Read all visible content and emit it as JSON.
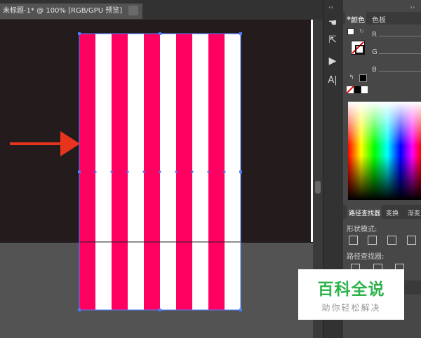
{
  "document": {
    "tab_title": "未标题-1* @ 100% [RGB/GPU 预览]"
  },
  "artwork": {
    "stripe_color": "#ff0060",
    "background_color": "#ffffff",
    "stripe_count": 5,
    "arrow_color": "#e8341c"
  },
  "panels": {
    "color_tab": "颜色",
    "swatches_tab": "色板",
    "channel_r": "R",
    "channel_g": "G",
    "channel_b": "B",
    "pathfinder_tab": "路径查找器",
    "transform_tab": "变换",
    "gradient_tab": "渐变",
    "shape_modes_label": "形状模式:",
    "pathfinders_label": "路径查找器:"
  },
  "watermark": {
    "title": "百科全说",
    "subtitle": "助你轻松解决"
  }
}
